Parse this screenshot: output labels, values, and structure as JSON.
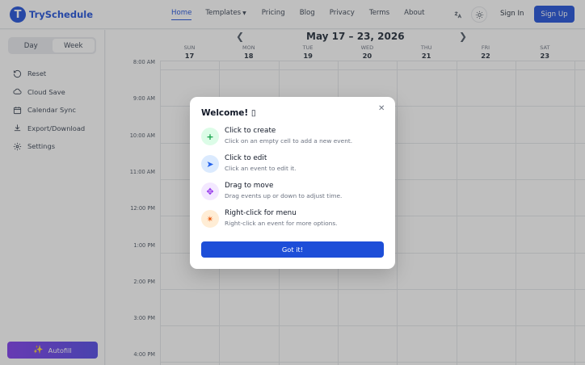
{
  "app": {
    "logo_letter": "T",
    "name": "TrySchedule"
  },
  "nav": {
    "home": "Home",
    "templates": "Templates",
    "pricing": "Pricing",
    "blog": "Blog",
    "privacy": "Privacy",
    "terms": "Terms",
    "about": "About",
    "sign_in": "Sign In",
    "sign_up": "Sign Up"
  },
  "icons": {
    "translate": "translate-icon",
    "theme": "sun-icon",
    "templates_chevron": "chevron-down-icon"
  },
  "sidebar": {
    "view_toggle": {
      "day": "Day",
      "week": "Week",
      "selected": "Week"
    },
    "items": [
      {
        "label": "Reset",
        "icon": "reset-icon"
      },
      {
        "label": "Cloud Save",
        "icon": "cloud-icon"
      },
      {
        "label": "Calendar Sync",
        "icon": "calendar-icon"
      },
      {
        "label": "Export/Download",
        "icon": "download-icon"
      },
      {
        "label": "Settings",
        "icon": "gear-icon"
      }
    ],
    "autofill": "Autofill"
  },
  "calendar": {
    "week_title": "May 17 – 23, 2026",
    "days": [
      {
        "name": "SUN",
        "date": "17"
      },
      {
        "name": "MON",
        "date": "18"
      },
      {
        "name": "TUE",
        "date": "19"
      },
      {
        "name": "WED",
        "date": "20"
      },
      {
        "name": "THU",
        "date": "21"
      },
      {
        "name": "FRI",
        "date": "22"
      },
      {
        "name": "SAT",
        "date": "23"
      }
    ],
    "times": [
      "8:00 AM",
      "9:00 AM",
      "10:00 AM",
      "11:00 AM",
      "12:00 PM",
      "1:00 PM",
      "2:00 PM",
      "3:00 PM",
      "4:00 PM"
    ]
  },
  "modal": {
    "title": "Welcome! ▯",
    "features": [
      {
        "title": "Click to create",
        "desc": "Click on an empty cell to add a new event.",
        "icon": "plus-icon",
        "glyph": "+",
        "bg": "#dcfce7",
        "fg": "#16a34a"
      },
      {
        "title": "Click to edit",
        "desc": "Click an event to edit it.",
        "icon": "pointer-icon",
        "glyph": "➤",
        "bg": "#dbeafe",
        "fg": "#2563eb"
      },
      {
        "title": "Drag to move",
        "desc": "Drag events up or down to adjust time.",
        "icon": "move-icon",
        "glyph": "✥",
        "bg": "#f3e8ff",
        "fg": "#9333ea"
      },
      {
        "title": "Right-click for menu",
        "desc": "Right-click an event for more options.",
        "icon": "menu-click-icon",
        "glyph": "✴",
        "bg": "#ffedd5",
        "fg": "#ea580c"
      }
    ],
    "button": "Got it!"
  },
  "colors": {
    "brand": "#1d4ed8",
    "autofill_gradient_start": "#7c3aed",
    "autofill_gradient_end": "#4f46e5",
    "overlay": "rgba(60,60,60,0.33)"
  }
}
